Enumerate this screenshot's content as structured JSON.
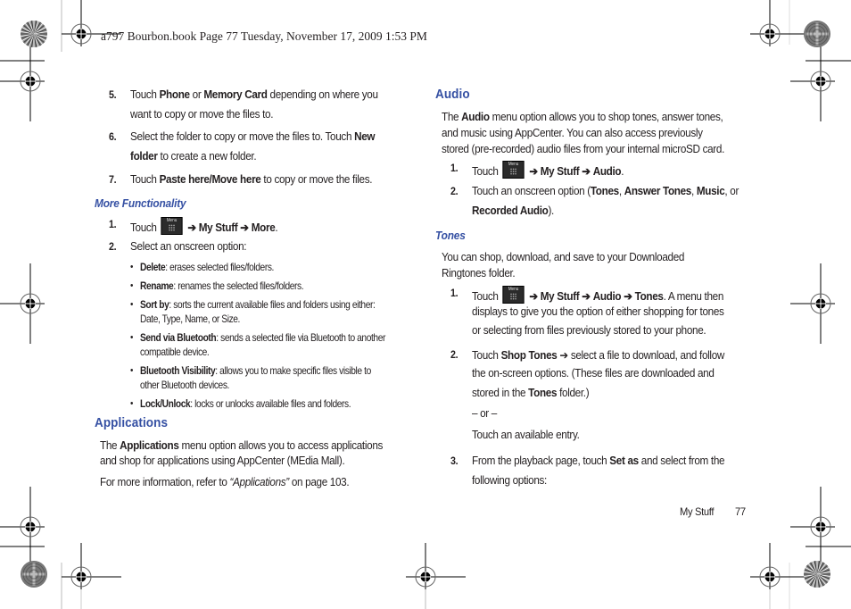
{
  "print_header": "a797 Bourbon.book  Page 77  Tuesday, November 17, 2009  1:53 PM",
  "left_column": {
    "steps_top": [
      {
        "num": "5.",
        "line1": [
          [
            "Touch ",
            false
          ],
          [
            "Phone",
            true
          ],
          [
            " or ",
            false
          ],
          [
            "Memory Card",
            true
          ],
          [
            " depending on where you",
            false
          ]
        ],
        "line2": [
          [
            "want to copy or move the files to.",
            false
          ]
        ]
      },
      {
        "num": "6.",
        "line1": [
          [
            "Select the folder to copy or move the files to. Touch ",
            false
          ],
          [
            "New",
            true
          ]
        ],
        "line2": [
          [
            "folder",
            true
          ],
          [
            " to create a new folder.",
            false
          ]
        ]
      },
      {
        "num": "7.",
        "line1": [
          [
            "Touch ",
            false
          ],
          [
            "Paste here/Move here",
            true
          ],
          [
            " to copy or move the files.",
            false
          ]
        ]
      }
    ],
    "more_functionality": {
      "heading": "More Functionality",
      "step1": {
        "num": "1.",
        "touch": "Touch",
        "menu_key_label": "Menu",
        "path": [
          "My Stuff",
          "More"
        ],
        "end": "."
      },
      "step2": {
        "num": "2.",
        "text": "Select an onscreen option:"
      },
      "options": [
        {
          "term": "Delete",
          "desc": ": erases selected files/folders."
        },
        {
          "term": "Rename",
          "desc": ": renames the selected files/folders."
        },
        {
          "term": "Sort by",
          "desc": ": sorts the current available files and folders using either:",
          "desc2": "Date, Type, Name, or Size."
        },
        {
          "term": "Send via Bluetooth",
          "desc": ": sends a selected file via Bluetooth to another",
          "desc2": "compatible device."
        },
        {
          "term": "Bluetooth Visibility",
          "desc": ": allows you to make specific files visible to",
          "desc2": "other Bluetooth devices."
        },
        {
          "term": "Lock/Unlock",
          "desc": ": locks or unlocks available files and folders."
        }
      ]
    },
    "applications": {
      "heading": "Applications",
      "para1_pre": "The ",
      "para1_bold": "Applications",
      "para1_post": " menu option allows you to access applications",
      "para1_line2": "and shop for applications using AppCenter (MEdia Mall).",
      "para2_pre": "For more information, refer to ",
      "para2_link": "“Applications”",
      "para2_post": "  on page 103."
    }
  },
  "right_column": {
    "audio": {
      "heading": "Audio",
      "para_line1_pre": "The ",
      "para_line1_bold": "Audio",
      "para_line1_post": " menu option allows you to shop tones, answer tones,",
      "para_line2": "and music using AppCenter. You can also access previously",
      "para_line3": "stored (pre-recorded) audio files from your internal microSD card.",
      "step1": {
        "num": "1.",
        "touch": "Touch",
        "menu_key_label": "Menu",
        "path": [
          "My Stuff",
          "Audio"
        ],
        "end": "."
      },
      "step2": {
        "num": "2.",
        "line1": [
          [
            "Touch an onscreen option (",
            false
          ],
          [
            "Tones",
            true
          ],
          [
            ", ",
            false
          ],
          [
            "Answer Tones",
            true
          ],
          [
            ", ",
            false
          ],
          [
            "Music",
            true
          ],
          [
            ", or",
            false
          ]
        ],
        "line2": [
          [
            "Recorded Audio",
            true
          ],
          [
            ").",
            false
          ]
        ]
      }
    },
    "tones": {
      "heading": "Tones",
      "para_line1": "You can shop, download, and save to your Downloaded",
      "para_line2": "Ringtones folder.",
      "step1": {
        "num": "1.",
        "touch": "Touch",
        "menu_key_label": "Menu",
        "path": [
          "My Stuff",
          "Audio",
          "Tones"
        ],
        "tail": ". A menu then",
        "line2": "displays to give you the option of either shopping for tones",
        "line3": "or selecting from files previously stored to your phone."
      },
      "step2": {
        "num": "2.",
        "line1": [
          [
            "Touch ",
            false
          ],
          [
            "Shop Tones",
            true
          ],
          [
            " ➔ select a file to download, and follow",
            false
          ]
        ],
        "line2": [
          [
            "the on-screen options. (These files are downloaded and",
            false
          ]
        ],
        "line3": [
          [
            "stored in the ",
            false
          ],
          [
            "Tones",
            true
          ],
          [
            " folder.)",
            false
          ]
        ]
      },
      "or_text": "– or –",
      "alt_text": "Touch an available entry.",
      "step3": {
        "num": "3.",
        "line1": [
          [
            "From the playback page, touch ",
            false
          ],
          [
            "Set as",
            true
          ],
          [
            " and select from the",
            false
          ]
        ],
        "line2": [
          [
            "following options:",
            false
          ]
        ]
      }
    }
  },
  "footer": {
    "section": "My Stuff",
    "page": "77"
  },
  "icons": {
    "arrow": "➔",
    "bullet": "•"
  },
  "colors": {
    "heading_blue": "#3550a3",
    "text": "#231f20"
  }
}
